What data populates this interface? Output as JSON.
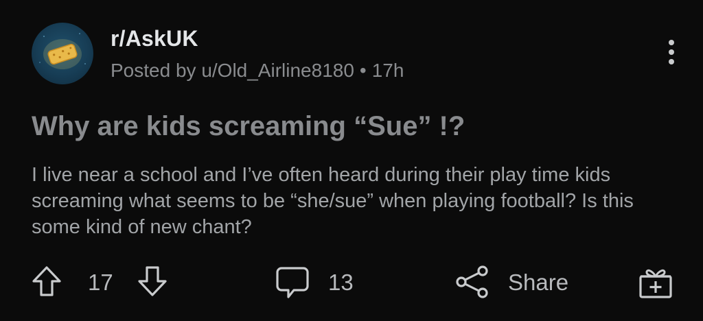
{
  "post": {
    "subreddit": "r/AskUK",
    "posted_by_prefix": "Posted by",
    "author": "u/Old_Airline8180",
    "separator": "•",
    "age": "17h",
    "title": "Why are kids screaming “Sue” !?",
    "body": "I live near a school and I’ve often heard during their play time kids screaming what seems to be “she/sue” when playing football? Is this some kind of new chant?"
  },
  "actions": {
    "upvote_icon": "arrow-up-icon",
    "score": "17",
    "downvote_icon": "arrow-down-icon",
    "comment_icon": "comment-bubble-icon",
    "comments": "13",
    "share_icon": "share-icon",
    "share_label": "Share",
    "award_icon": "gift-icon"
  },
  "colors": {
    "background": "#0b0b0b",
    "title": "#898b8e",
    "body": "#a2a5a8",
    "meta": "#8a8c8f"
  }
}
